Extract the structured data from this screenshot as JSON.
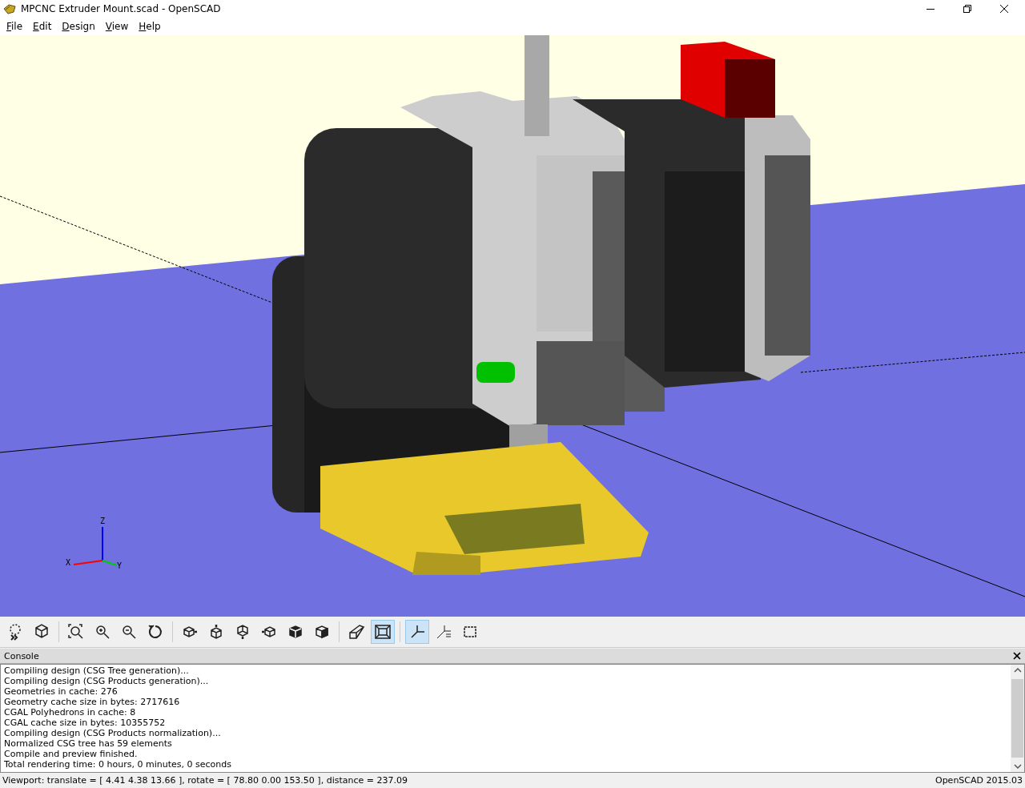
{
  "window": {
    "title": "MPCNC Extruder Mount.scad - OpenSCAD"
  },
  "menu": [
    "File",
    "Edit",
    "Design",
    "View",
    "Help"
  ],
  "viewport": {
    "axis_labels": [
      {
        "kind": "z",
        "text": "Z"
      },
      {
        "kind": "x",
        "text": "X"
      },
      {
        "kind": "y",
        "text": "Y"
      }
    ]
  },
  "toolbar": {
    "groups": [
      [
        {
          "kind": "preview",
          "on": false
        },
        {
          "kind": "render",
          "on": false
        }
      ],
      [
        {
          "kind": "view-all",
          "on": false
        },
        {
          "kind": "zoom-in",
          "on": false
        },
        {
          "kind": "zoom-out",
          "on": false
        },
        {
          "kind": "reset-view",
          "on": false
        }
      ],
      [
        {
          "kind": "right",
          "on": false
        },
        {
          "kind": "top",
          "on": false
        },
        {
          "kind": "bottom",
          "on": false
        },
        {
          "kind": "left",
          "on": false
        },
        {
          "kind": "front",
          "on": false
        },
        {
          "kind": "back",
          "on": false
        }
      ],
      [
        {
          "kind": "perspective",
          "on": false
        },
        {
          "kind": "orthogonal",
          "on": true
        }
      ],
      [
        {
          "kind": "axes",
          "on": true
        },
        {
          "kind": "scale-markers",
          "on": false
        },
        {
          "kind": "edges",
          "on": false
        }
      ]
    ]
  },
  "console": {
    "title": "Console",
    "lines": [
      "Compiling design (CSG Tree generation)...",
      "Compiling design (CSG Products generation)...",
      "Geometries in cache: 276",
      "Geometry cache size in bytes: 2717616",
      "CGAL Polyhedrons in cache: 8",
      "CGAL cache size in bytes: 10355752",
      "Compiling design (CSG Products normalization)...",
      "Normalized CSG tree has 59 elements",
      "Compile and preview finished.",
      "Total rendering time: 0 hours, 0 minutes, 0 seconds"
    ]
  },
  "status_bar": {
    "viewport": "Viewport: translate = [ 4.41 4.38 13.66 ], rotate = [ 78.80 0.00 153.50 ], distance = 237.09",
    "version": "OpenSCAD 2015.03"
  }
}
